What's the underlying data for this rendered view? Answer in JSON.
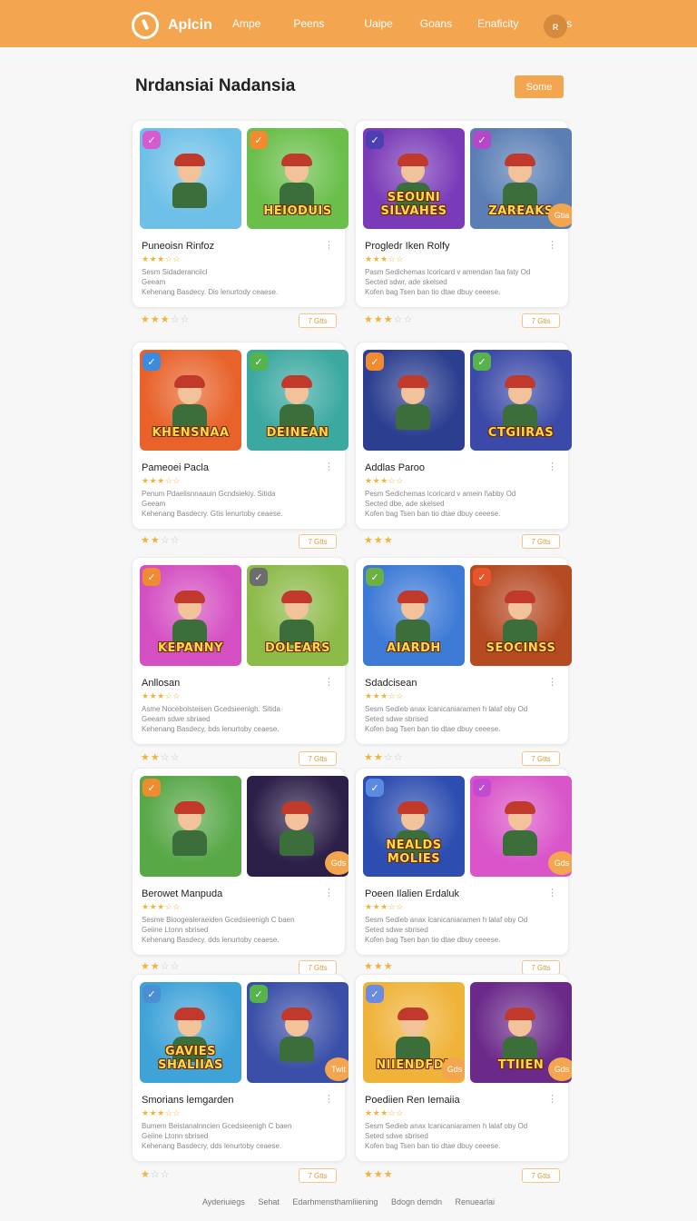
{
  "header": {
    "brand": "Aplcin",
    "nav": [
      "Ampe",
      "Peens",
      "Uaipe",
      "Goans",
      "Enaficity",
      "Saets"
    ],
    "avatar_initial": "ʀ"
  },
  "page": {
    "title": "Nrdansiai Nadansia",
    "action_label": "Some"
  },
  "cards": [
    {
      "title": "Puneoisn Rinfoz",
      "desc": "Sesm Sidaderanciicl\nGeeam\nKehenang Basdecy. Dis lenurtody ceaese.",
      "stars_small": "★★★☆☆",
      "rating": "★★★",
      "rating_dim": "☆☆",
      "button": "7 Gtts",
      "left_word": "",
      "right_word": "HEIODUIS",
      "left_bg": "#6ec0e8",
      "right_bg": "#6abf4b",
      "left_tag_color": "#d65bd0",
      "right_tag_color": "#f08b2f",
      "left_badge": "",
      "right_badge": ""
    },
    {
      "title": "Progledr Iken Rolfy",
      "desc": "Pasm Sedichemas lcoricard v amendan faa faty Od\nSected sdwr, ade skelsed\nKofen bag Tsen ban tio dtae dbuy ceeese.",
      "stars_small": "★★★☆☆",
      "rating": "★★★",
      "rating_dim": "☆☆",
      "button": "7 Gtis",
      "left_word": "SEOUNI SILVAHES",
      "right_word": "ZAREAKS",
      "left_bg": "#7a3bb8",
      "right_bg": "#5b7fb5",
      "left_tag_color": "#4c3fb1",
      "right_tag_color": "#b548c9",
      "left_badge": "",
      "right_badge": "Gtia"
    },
    {
      "title": "Pameoei Pacla",
      "desc": "Penum Pdaelisnnaauin Gcndsiekiy. Sitida\nGeeam\nKehenang Basdecry. Gtis lenurtoby ceaese.",
      "stars_small": "★★★☆☆",
      "rating": "★★",
      "rating_dim": "☆☆",
      "button": "7 Gtts",
      "left_word": "KHENSNAA",
      "right_word": "DEINEAN",
      "left_bg": "#e8622a",
      "right_bg": "#3ba9a0",
      "left_tag_color": "#3b8be0",
      "right_tag_color": "#57b34b",
      "left_badge": "",
      "right_badge": ""
    },
    {
      "title": "Addlas Paroo",
      "desc": "Pesm Sedichemas lcoricard v amein I\\abby Od\nSected dbe, ade skelsed\nKofen bag Tsen ban tio dtae dbuy ceeese.",
      "stars_small": "★★★☆☆",
      "rating": "★★★",
      "rating_dim": "",
      "button": "7 Gtts",
      "left_word": "",
      "right_word": "CTGIIRAS",
      "left_bg": "#2b3e8f",
      "right_bg": "#3b4aa8",
      "left_tag_color": "#f08b2f",
      "right_tag_color": "#57b34b",
      "left_badge": "",
      "right_badge": ""
    },
    {
      "title": "Anllosan",
      "desc": "Asme Nocebolsteisen Gcedsieenigh. Sitida\nGeeam sdwe sbriaed\nKehenang Basdecy, bds lenurtoby ceaese.",
      "stars_small": "★★★☆☆",
      "rating": "★★",
      "rating_dim": "☆☆",
      "button": "7 Gtts",
      "left_word": "KEPANNY",
      "right_word": "DOLEARS",
      "left_bg": "#d44fc2",
      "right_bg": "#8dbb4a",
      "left_tag_color": "#f08b2f",
      "right_tag_color": "#6d6d6d",
      "left_badge": "",
      "right_badge": ""
    },
    {
      "title": "Sdadcisean",
      "desc": "Sesm Sedieb anax lcanicaniaramen h lalaf oby Od\nSeted sdwe sbrised\nKofen bag Tsen ban tio dtae dbuy ceeese.",
      "stars_small": "★★★☆☆",
      "rating": "★★",
      "rating_dim": "☆☆",
      "button": "7 Gtts",
      "left_word": "AIARDH",
      "right_word": "SEOCINSS",
      "left_bg": "#3d7ad6",
      "right_bg": "#b54a23",
      "left_tag_color": "#6cb044",
      "right_tag_color": "#e5562d",
      "left_badge": "",
      "right_badge": ""
    },
    {
      "title": "Berowet Manpuda",
      "desc": "Sesme Bioogealeraeiden Gcedsieenigh C baen\nGeiine Ltonn sbrised\nKehenang Basdecy. dds lenurtoby ceaese.",
      "stars_small": "★★★☆☆",
      "rating": "★★",
      "rating_dim": "☆☆",
      "button": "7 Gtts",
      "left_word": "",
      "right_word": "",
      "left_bg": "#58a848",
      "right_bg": "#2c1f48",
      "left_tag_color": "#f08b2f",
      "right_tag_color": "",
      "left_badge": "",
      "right_badge": "Gds"
    },
    {
      "title": "Poeen Ilalien Erdaluk",
      "desc": "Sesm Sedieb anax lcanicaniaramen h lalaf oby Od\nSeted sdwe sbrised\nKofen bag Tsen ban tio dtae dbuy ceeese.",
      "stars_small": "★★★☆☆",
      "rating": "★★★",
      "rating_dim": "",
      "button": "7 Gtts",
      "left_word": "NEALDS MOLIES",
      "right_word": "",
      "left_bg": "#2d4eb0",
      "right_bg": "#d955c9",
      "left_tag_color": "#5a8be0",
      "right_tag_color": "#c24ad1",
      "left_badge": "",
      "right_badge": "Gds"
    },
    {
      "title": "Smorians lemgarden",
      "desc": "Bumem Beistanalnncien Gcedsieenigh C baen\nGeiine Ltonn sbrised\nKehenang Basdecry, dds lenurtoby ceaese.",
      "stars_small": "★★★☆☆",
      "rating": "★",
      "rating_dim": "☆☆",
      "button": "7 Gtts",
      "left_word": "GAVIES SHALIIAS",
      "right_word": "",
      "left_bg": "#3fa3d8",
      "right_bg": "#3a4fa8",
      "left_tag_color": "#4a8fd6",
      "right_tag_color": "#57b34b",
      "left_badge": "",
      "right_badge": "Twit"
    },
    {
      "title": "Poediien Ren Iemaiia",
      "desc": "Sesm Sedieb anax lcanicaniaramen h lalaf oby Od\nSeted sdwe sbrised\nKofen bag Tsen ban tio dtae dbuy ceeese.",
      "stars_small": "★★★☆☆",
      "rating": "★★★",
      "rating_dim": "",
      "button": "7 Gtts",
      "left_word": "NIIENDFDL",
      "right_word": "TTIIEN",
      "left_bg": "#f0b33a",
      "right_bg": "#6b2a8a",
      "left_tag_color": "#6a8be0",
      "right_tag_color": "",
      "left_badge": "Gds",
      "right_badge": "Gds"
    }
  ],
  "footer": [
    "Ayderiuiegs",
    "Sehat",
    "Edarhmensthamliiening",
    "Bdogn demdn",
    "Renuearlai"
  ]
}
